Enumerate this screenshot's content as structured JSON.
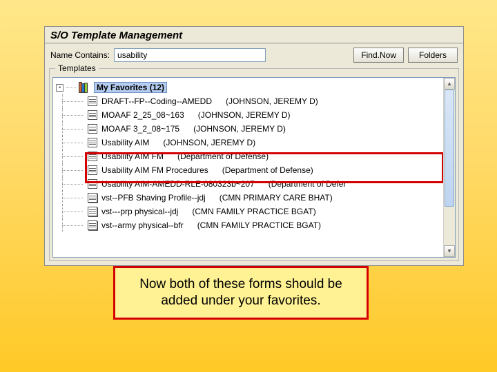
{
  "window": {
    "title": "S/O Template Management",
    "fieldset_label": "Templates"
  },
  "search": {
    "label": "Name Contains:",
    "value": "usability",
    "find_btn": "Find.Now",
    "folders_btn": "Folders"
  },
  "favorites_root": {
    "label": "My Favorites (12)",
    "expander": "-"
  },
  "items": [
    {
      "icon": "doc",
      "name": "DRAFT--FP--Coding--AMEDD",
      "owner": "(JOHNSON, JEREMY D)"
    },
    {
      "icon": "doc",
      "name": "MOAAF 2_25_08~163",
      "owner": "(JOHNSON, JEREMY D)"
    },
    {
      "icon": "doc",
      "name": "MOAAF 3_2_08~175",
      "owner": "(JOHNSON, JEREMY D)"
    },
    {
      "icon": "doc",
      "name": "Usability AIM",
      "owner": "(JOHNSON, JEREMY D)"
    },
    {
      "icon": "doc",
      "name": "Usability AIM FM",
      "owner": "(Department of Defense)"
    },
    {
      "icon": "doc",
      "name": "Usability AIM FM Procedures",
      "owner": "(Department of Defense)"
    },
    {
      "icon": "doc",
      "name": "Usability AIM-AMEDD-RLE-080323b~207",
      "owner": "(Department of Defer"
    },
    {
      "icon": "stack",
      "name": "vst--PFB Shaving Profile--jdj",
      "owner": "(CMN PRIMARY CARE BHAT)"
    },
    {
      "icon": "stack",
      "name": "vst---prp physical--jdj",
      "owner": "(CMN FAMILY PRACTICE BGAT)"
    },
    {
      "icon": "stack",
      "name": "vst--army physical--bfr",
      "owner": "(CMN FAMILY PRACTICE BGAT)"
    }
  ],
  "instruction": "Now both of these forms should be added under your favorites."
}
